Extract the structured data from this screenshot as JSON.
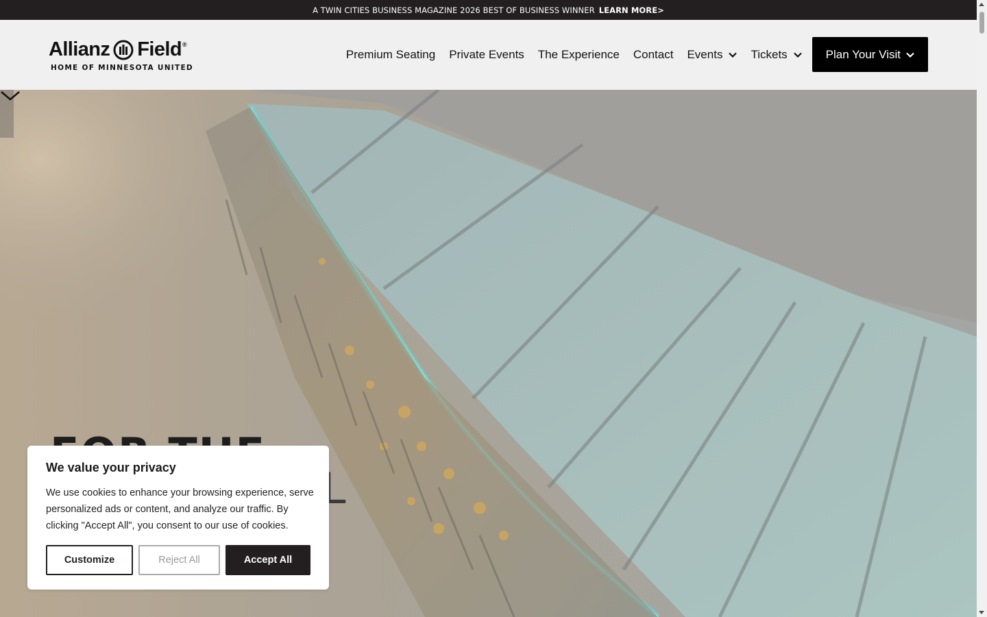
{
  "announcement": {
    "text": "A TWIN CITIES BUSINESS MAGAZINE 2026 BEST OF BUSINESS WINNER",
    "link": "LEARN MORE>"
  },
  "header": {
    "logo_main_left": "Allianz",
    "logo_main_right": "Field",
    "logo_reg": "®",
    "logo_sub": "HOME OF MINNESOTA UNITED",
    "nav": [
      {
        "label": "Premium Seating"
      },
      {
        "label": "Private Events"
      },
      {
        "label": "The Experience"
      },
      {
        "label": "Contact"
      },
      {
        "label": "Events",
        "dropdown": true
      },
      {
        "label": "Tickets",
        "dropdown": true
      }
    ],
    "cta": {
      "label": "Plan Your Visit"
    }
  },
  "hero": {
    "title_line1": "FOR THE",
    "title_line2": "L"
  },
  "cookie": {
    "title": "We value your privacy",
    "text": "We use cookies to enhance your browsing experience, serve personalized ads or content, and analyze our traffic. By clicking \"Accept All\", you consent to our use of cookies.",
    "customize": "Customize",
    "reject": "Reject All",
    "accept": "Accept All"
  },
  "colors": {
    "dark": "#231f20",
    "header_bg": "#f0f0f0",
    "teal_glow": "#5ed6d0",
    "amber": "#d6a44a"
  }
}
